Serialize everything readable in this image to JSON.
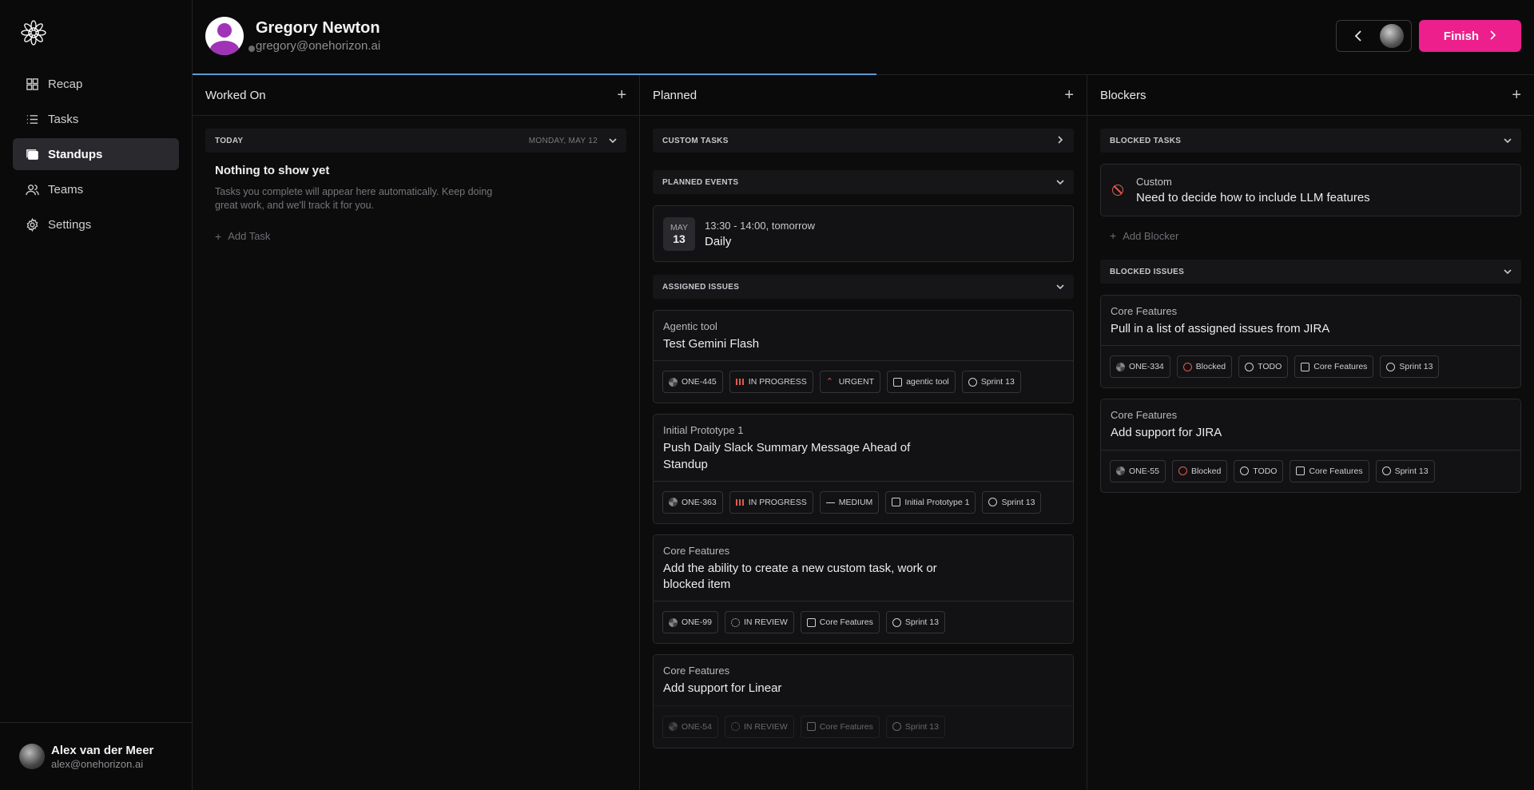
{
  "sidebar": {
    "items": [
      {
        "label": "Recap",
        "icon": "recap-icon"
      },
      {
        "label": "Tasks",
        "icon": "list-icon"
      },
      {
        "label": "Standups",
        "icon": "standups-icon",
        "active": true
      },
      {
        "label": "Teams",
        "icon": "users-icon"
      },
      {
        "label": "Settings",
        "icon": "gear-icon"
      }
    ],
    "user": {
      "name": "Alex van der Meer",
      "email": "alex@onehorizon.ai"
    }
  },
  "header": {
    "name": "Gregory Newton",
    "email": "gregory@onehorizon.ai",
    "finish_label": "Finish",
    "progress_fraction": 0.51
  },
  "columns": {
    "worked": {
      "title": "Worked On",
      "section_label": "TODAY",
      "section_date": "MONDAY, MAY 12",
      "empty_title": "Nothing to show yet",
      "empty_text": "Tasks you complete will appear here automatically. Keep doing great work, and we'll track it for you.",
      "add_label": "Add Task"
    },
    "planned": {
      "title": "Planned",
      "custom_label": "CUSTOM TASKS",
      "events_label": "PLANNED EVENTS",
      "event": {
        "month": "MAY",
        "day": "13",
        "time": "13:30 - 14:00, tomorrow",
        "title": "Daily"
      },
      "issues_label": "ASSIGNED ISSUES",
      "issues": [
        {
          "project": "Agentic tool",
          "title": "Test Gemini Flash",
          "id": "ONE-445",
          "status": "IN PROGRESS",
          "priority": "URGENT",
          "label": "agentic tool",
          "sprint": "Sprint 13"
        },
        {
          "project": "Initial Prototype 1",
          "title": "Push Daily Slack Summary Message Ahead of Standup",
          "id": "ONE-363",
          "status": "IN PROGRESS",
          "priority": "MEDIUM",
          "label": "Initial Prototype 1",
          "sprint": "Sprint 13"
        },
        {
          "project": "Core Features",
          "title": "Add the ability to create a new custom task, work or blocked item",
          "id": "ONE-99",
          "status": "IN REVIEW",
          "label": "Core Features",
          "sprint": "Sprint 13"
        },
        {
          "project": "Core Features",
          "title": "Add support for Linear",
          "id": "ONE-54",
          "status": "IN REVIEW",
          "label": "Core Features",
          "sprint": "Sprint 13"
        }
      ]
    },
    "blockers": {
      "title": "Blockers",
      "tasks_label": "BLOCKED TASKS",
      "custom": {
        "type": "Custom",
        "text": "Need to decide how to include LLM features"
      },
      "add_label": "Add Blocker",
      "issues_label": "BLOCKED ISSUES",
      "issues": [
        {
          "project": "Core Features",
          "title": "Pull in a list of assigned issues from JIRA",
          "id": "ONE-334",
          "status": "Blocked",
          "state": "TODO",
          "label": "Core Features",
          "sprint": "Sprint 13"
        },
        {
          "project": "Core Features",
          "title": "Add support for JIRA",
          "id": "ONE-55",
          "status": "Blocked",
          "state": "TODO",
          "label": "Core Features",
          "sprint": "Sprint 13"
        }
      ]
    }
  },
  "colors": {
    "accent": "#ec1f8d",
    "progress": "#5b9bd5",
    "danger": "#e05a4e"
  }
}
